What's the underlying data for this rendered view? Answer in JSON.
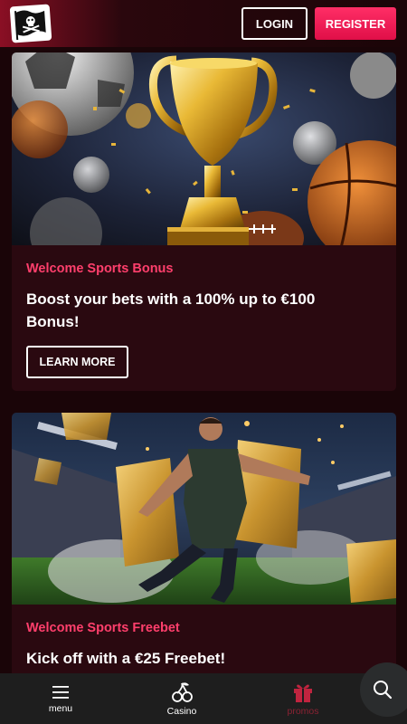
{
  "header": {
    "logo_icon": "pirate-flag-icon",
    "login_label": "LOGIN",
    "register_label": "REGISTER"
  },
  "promos": [
    {
      "kicker": "Welcome Sports Bonus",
      "title": "Boost your bets with a 100% up to €100 Bonus!",
      "cta_label": "LEARN MORE",
      "image_subject": "trophy-sports-balls"
    },
    {
      "kicker": "Welcome Sports Freebet",
      "title": "Kick off with a €25 Freebet!",
      "image_subject": "soccer-player-golden-tickets"
    }
  ],
  "bottom_nav": {
    "items": [
      {
        "label": "menu",
        "icon": "hamburger-menu-icon"
      },
      {
        "label": "Casino",
        "icon": "cherries-icon"
      },
      {
        "label": "promos",
        "icon": "gift-icon"
      }
    ],
    "search_icon": "search-icon"
  },
  "colors": {
    "accent": "#ff2e66",
    "kicker": "#ff3f6c",
    "card_bg": "#2a0910",
    "page_bg": "#1a0508",
    "nav_bg": "#1e1e1e"
  }
}
